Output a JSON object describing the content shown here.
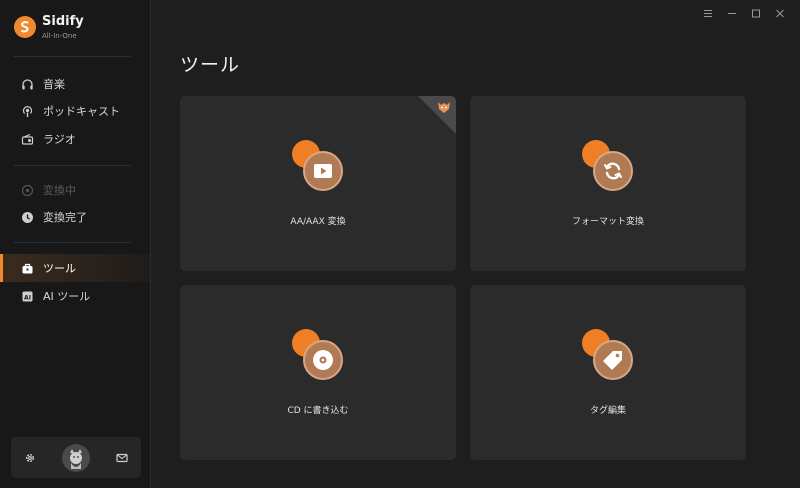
{
  "app": {
    "name": "Sidify",
    "subtitle": "All-In-One"
  },
  "sidebar": {
    "sources": [
      {
        "label": "音楽",
        "icon": "headphones-icon"
      },
      {
        "label": "ポッドキャスト",
        "icon": "podcast-icon"
      },
      {
        "label": "ラジオ",
        "icon": "radio-icon"
      }
    ],
    "status": [
      {
        "label": "変換中",
        "icon": "converting-icon",
        "state": "disabled"
      },
      {
        "label": "変換完了",
        "icon": "clock-icon",
        "state": "normal"
      }
    ],
    "tools": [
      {
        "label": "ツール",
        "icon": "toolbox-icon",
        "state": "active"
      },
      {
        "label": "AI ツール",
        "icon": "ai-icon",
        "state": "normal"
      }
    ],
    "bottom": {
      "settings_icon": "gear-icon",
      "avatar": "avatar",
      "mail_icon": "mail-icon"
    }
  },
  "window_controls": [
    "menu-icon",
    "minimize-icon",
    "maximize-icon",
    "close-icon"
  ],
  "main": {
    "title": "ツール",
    "cards": [
      {
        "label": "AA/AAX 変換",
        "icon": "play-video-icon",
        "badge": "premium-fox-badge"
      },
      {
        "label": "フォーマット変換",
        "icon": "refresh-icon"
      },
      {
        "label": "CD に書き込む",
        "icon": "disc-icon"
      },
      {
        "label": "タグ編集",
        "icon": "tag-icon"
      }
    ]
  },
  "colors": {
    "accent": "#f08a2c",
    "background": "#1e1e1e",
    "sidebar": "#181818",
    "card": "#2b2b2b"
  }
}
